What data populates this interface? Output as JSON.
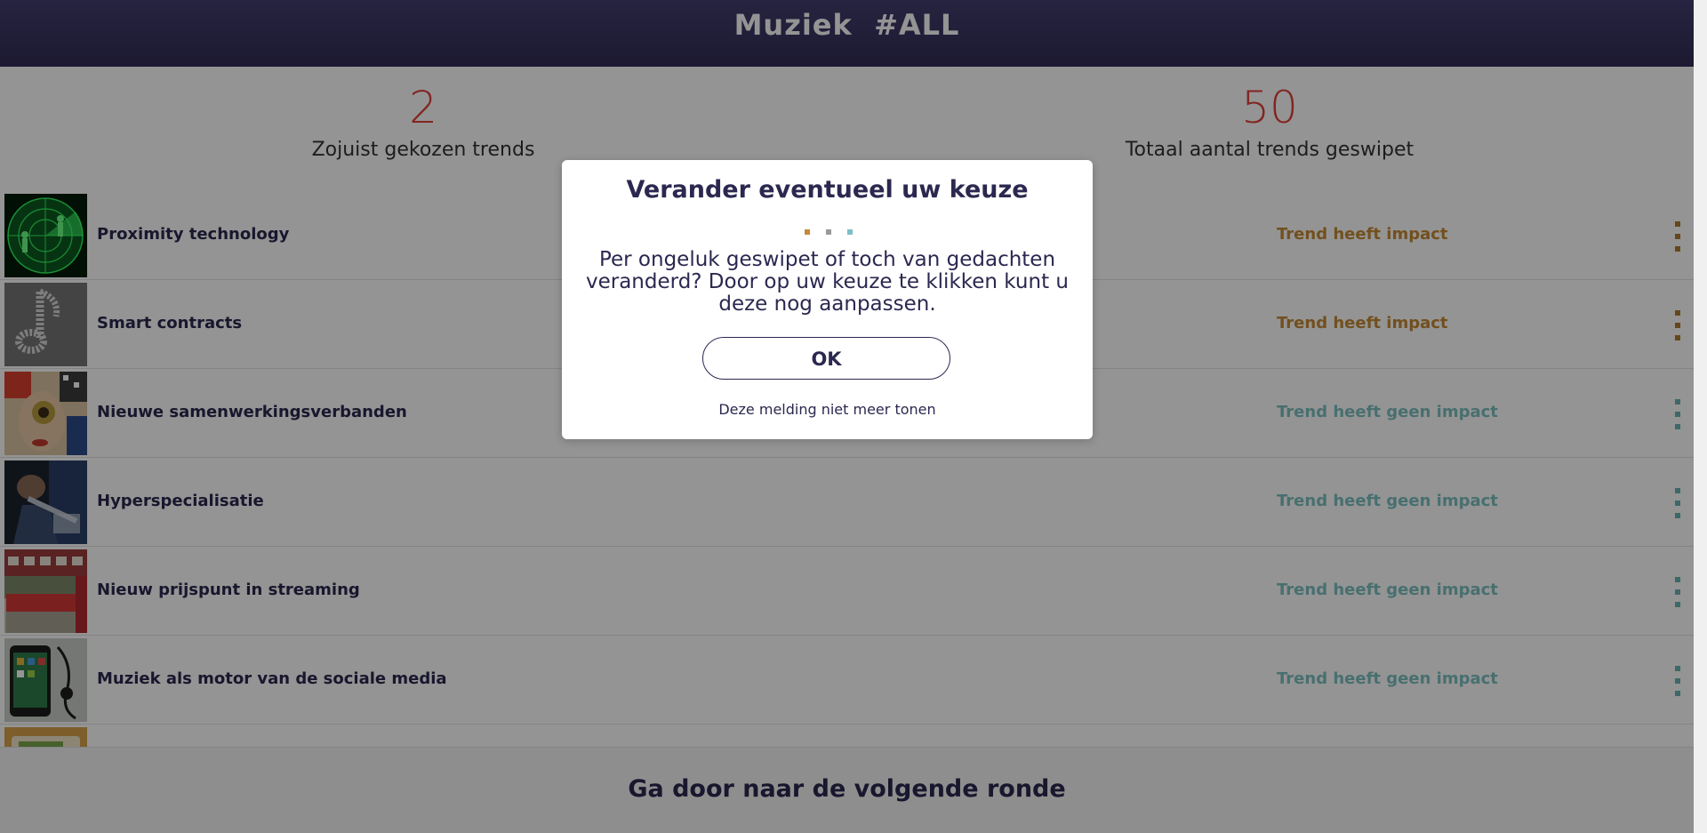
{
  "header": {
    "title": "Muziek  #ALL"
  },
  "stats": {
    "chosen": {
      "value": "2",
      "label": "Zojuist gekozen trends"
    },
    "total": {
      "value": "50",
      "label": "Totaal aantal trends geswipet"
    }
  },
  "trends": [
    {
      "title": "Proximity technology",
      "impact": "Trend heeft impact",
      "has_impact": true
    },
    {
      "title": "Smart contracts",
      "impact": "Trend heeft impact",
      "has_impact": true
    },
    {
      "title": "Nieuwe samenwerkingsverbanden",
      "impact": "Trend heeft geen impact",
      "has_impact": false
    },
    {
      "title": "Hyperspecialisatie",
      "impact": "Trend heeft geen impact",
      "has_impact": false
    },
    {
      "title": "Nieuw prijspunt in streaming",
      "impact": "Trend heeft geen impact",
      "has_impact": false
    },
    {
      "title": "Muziek als motor van de sociale media",
      "impact": "Trend heeft geen impact",
      "has_impact": false
    }
  ],
  "footer": {
    "next_round": "Ga door naar de volgende ronde"
  },
  "modal": {
    "title": "Verander eventueel uw keuze",
    "body": "Per ongeluk geswipet of toch van gedachten veranderd? Door op uw keuze te klikken kunt u deze nog aanpassen.",
    "ok_label": "OK",
    "dismiss_label": "Deze melding niet meer tonen"
  },
  "colors": {
    "header": "#3a3562",
    "accent_red": "#e0403a",
    "impact": "#c58a35",
    "no_impact": "#7dbfc0",
    "text_dark": "#2b2850"
  }
}
